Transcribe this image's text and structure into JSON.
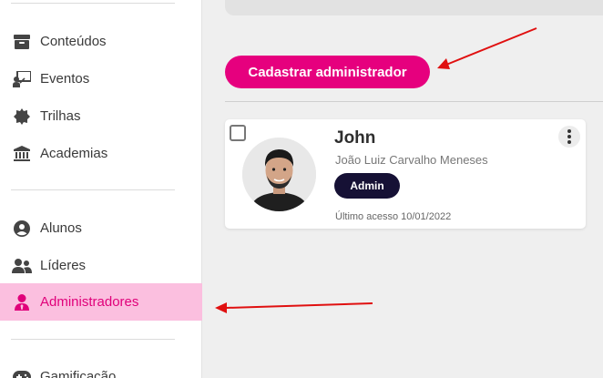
{
  "sidebar": {
    "items": [
      {
        "label": "Conteúdos",
        "icon": "archive-icon"
      },
      {
        "label": "Eventos",
        "icon": "presentation-icon"
      },
      {
        "label": "Trilhas",
        "icon": "badge-icon"
      },
      {
        "label": "Academias",
        "icon": "institution-icon"
      },
      {
        "label": "Alunos",
        "icon": "user-circle-icon"
      },
      {
        "label": "Líderes",
        "icon": "users-icon"
      },
      {
        "label": "Administradores",
        "icon": "user-tie-icon",
        "active": true
      },
      {
        "label": "Gamificação",
        "icon": "gamepad-icon"
      }
    ]
  },
  "main": {
    "cta_label": "Cadastrar administrador",
    "card": {
      "name": "John",
      "full_name": "João Luiz Carvalho Meneses",
      "badge": "Admin",
      "last_access": "Último acesso 10/01/2022"
    }
  },
  "colors": {
    "accent": "#e6007e",
    "active_bg": "#fbbfdf",
    "badge_bg": "#161135",
    "annotation_arrow": "#e01010"
  }
}
